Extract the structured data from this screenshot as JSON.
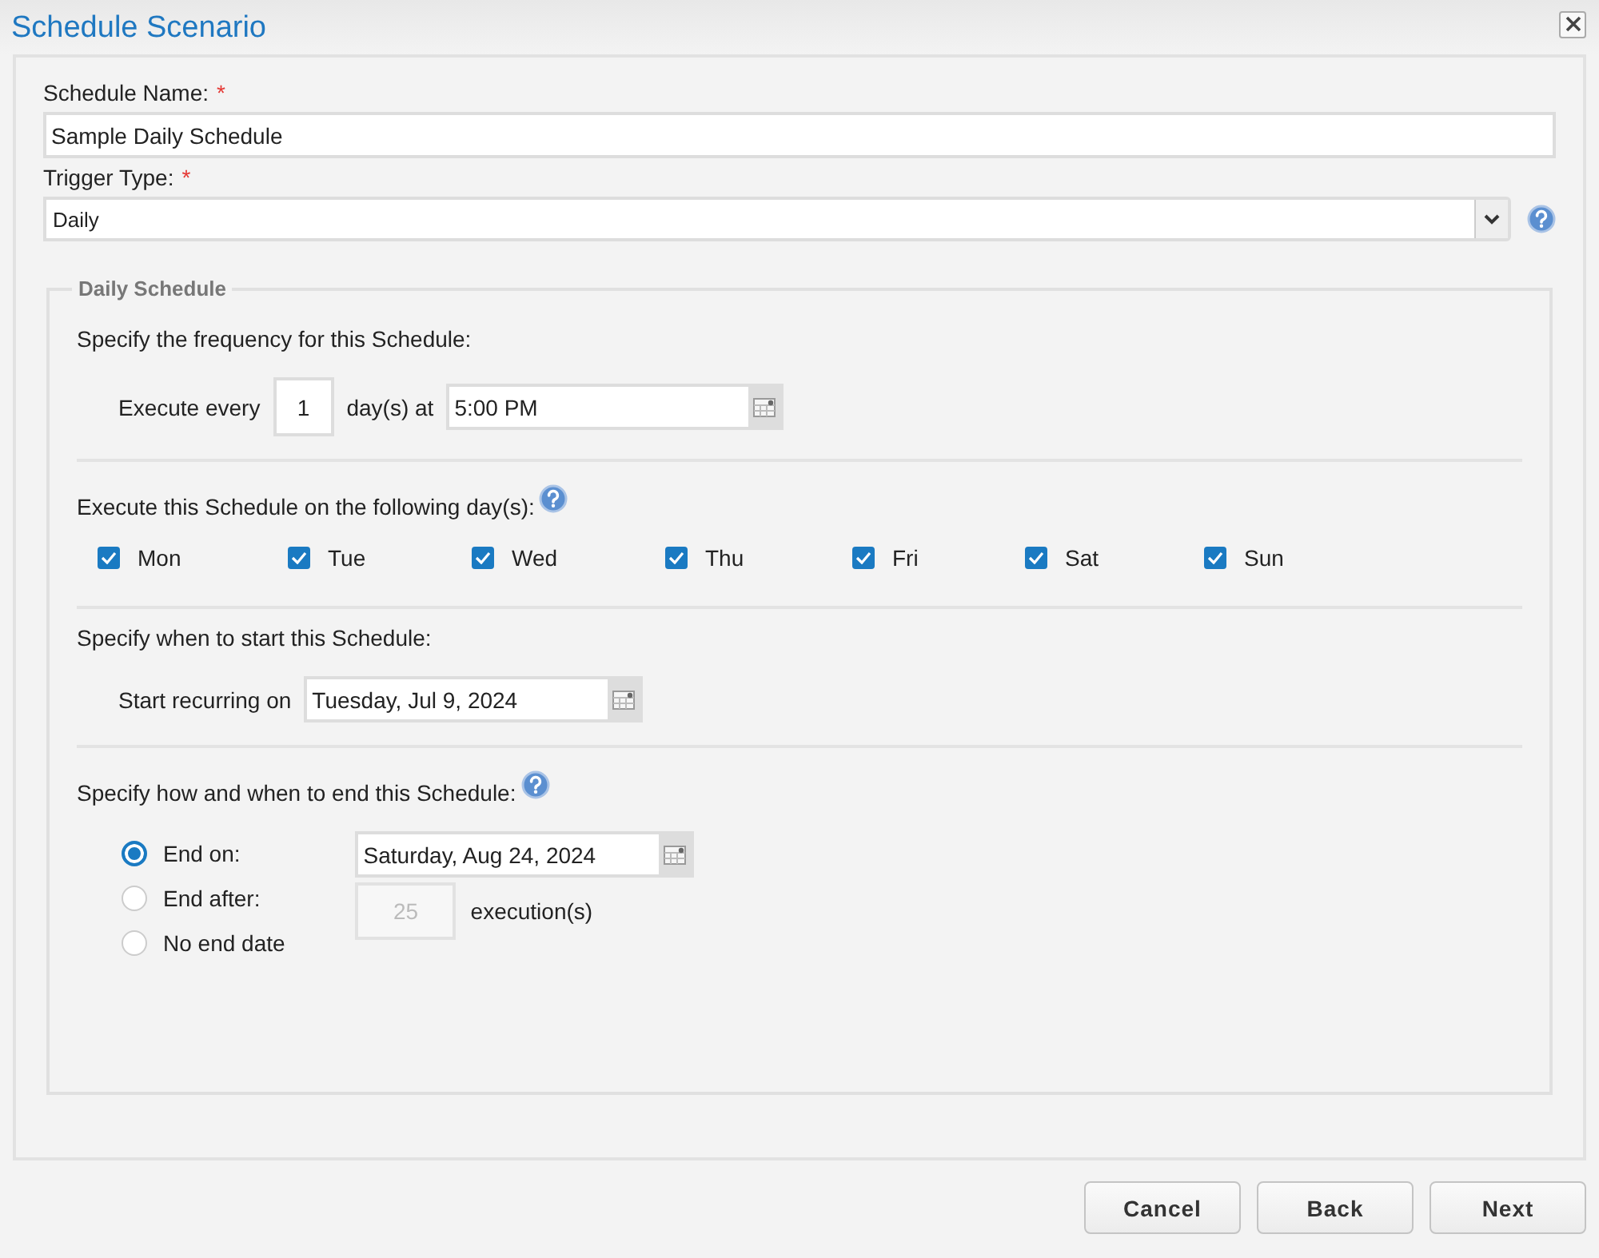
{
  "window": {
    "title": "Schedule Scenario"
  },
  "schedule_name": {
    "label": "Schedule Name:",
    "required_mark": "*",
    "value": "Sample Daily Schedule"
  },
  "trigger_type": {
    "label": "Trigger Type:",
    "required_mark": "*",
    "value": "Daily"
  },
  "daily_schedule": {
    "legend": "Daily Schedule",
    "frequency": {
      "heading": "Specify the frequency for this Schedule:",
      "prefix": "Execute every",
      "interval": "1",
      "unit": "day(s) at",
      "time": "5:00 PM"
    },
    "days": {
      "heading": "Execute this Schedule on the following day(s):",
      "items": [
        {
          "label": "Mon",
          "checked": true
        },
        {
          "label": "Tue",
          "checked": true
        },
        {
          "label": "Wed",
          "checked": true
        },
        {
          "label": "Thu",
          "checked": true
        },
        {
          "label": "Fri",
          "checked": true
        },
        {
          "label": "Sat",
          "checked": true
        },
        {
          "label": "Sun",
          "checked": true
        }
      ]
    },
    "start": {
      "heading": "Specify when to start this Schedule:",
      "label": "Start recurring on",
      "date": "Tuesday, Jul 9, 2024"
    },
    "end": {
      "heading": "Specify how and when to end this Schedule:",
      "options": [
        {
          "label": "End on:",
          "selected": true
        },
        {
          "label": "End after:",
          "selected": false
        },
        {
          "label": "No end date",
          "selected": false
        }
      ],
      "end_date": "Saturday, Aug 24, 2024",
      "count": {
        "value": "25",
        "disabled": true
      },
      "count_unit": "execution(s)"
    }
  },
  "buttons": [
    "Cancel",
    "Back",
    "Next"
  ]
}
